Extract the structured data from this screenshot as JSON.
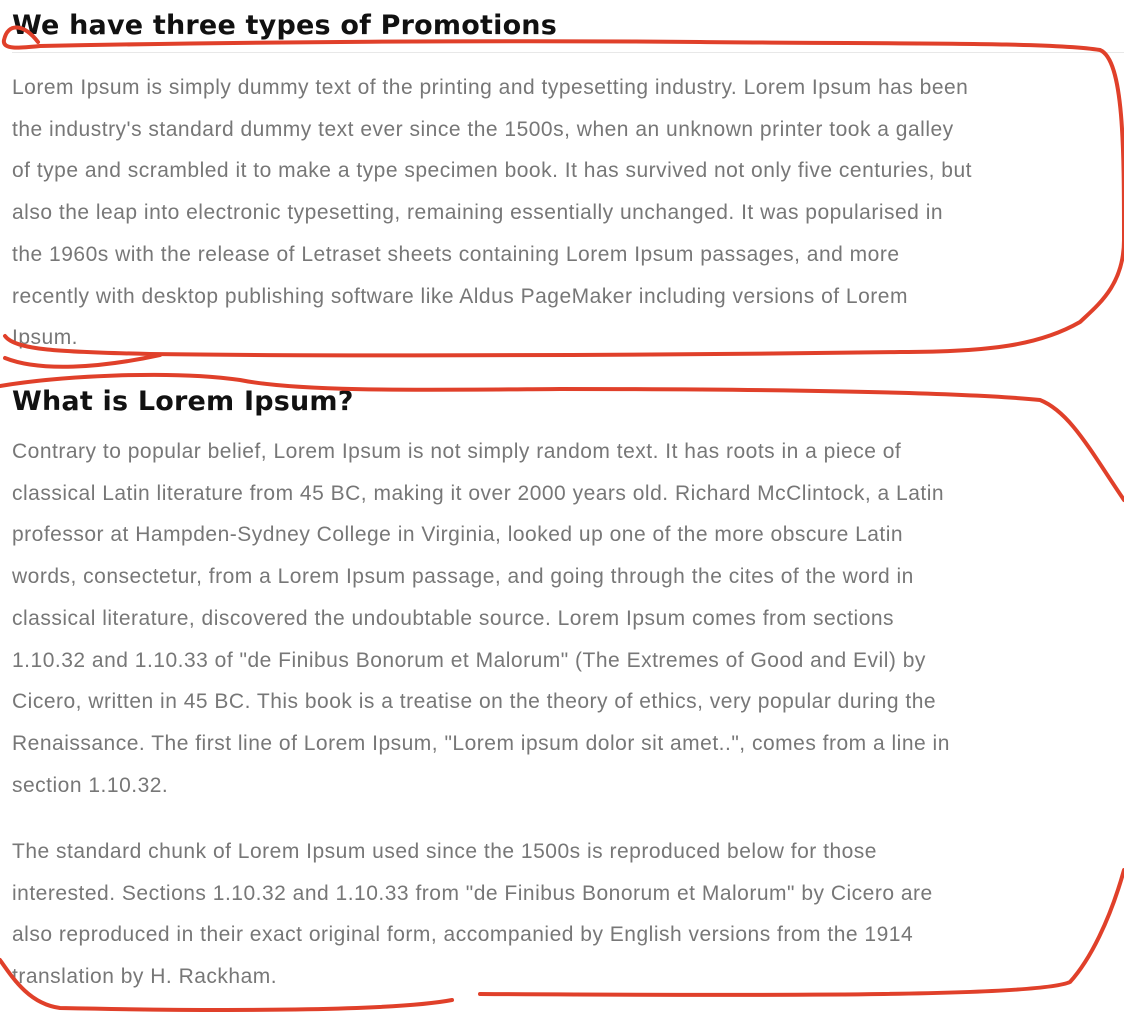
{
  "promotions": {
    "heading": "We have three types of Promotions",
    "paragraph_lines": [
      "Lorem Ipsum is simply dummy text of the printing and typesetting industry. Lorem Ipsum has been",
      "the industry's standard dummy text ever since the 1500s, when an unknown printer took a galley",
      "of type and scrambled it to make a type specimen book. It has survived not only five centuries, but",
      "also the leap into electronic typesetting, remaining essentially unchanged. It was popularised in",
      "the 1960s with the release of Letraset sheets containing Lorem Ipsum passages, and more",
      "recently with desktop publishing software like Aldus PageMaker including versions of Lorem",
      "Ipsum."
    ]
  },
  "lorem_section": {
    "heading": "What is Lorem Ipsum?",
    "paragraph1_lines": [
      "Contrary to popular belief, Lorem Ipsum is not simply random text. It has roots in a piece of",
      "classical Latin literature from 45 BC, making it over 2000 years old. Richard McClintock, a Latin",
      "professor at Hampden-Sydney College in Virginia, looked up one of the more obscure Latin",
      "words, consectetur, from a Lorem Ipsum passage, and going through the cites of the word in",
      "classical literature, discovered the undoubtable source. Lorem Ipsum comes from sections",
      "1.10.32 and 1.10.33 of \"de Finibus Bonorum et Malorum\" (The Extremes of Good and Evil) by",
      "Cicero, written in 45 BC. This book is a treatise on the theory of ethics, very popular during the",
      "Renaissance. The first line of Lorem Ipsum, \"Lorem ipsum dolor sit amet..\", comes from a line in",
      "section 1.10.32."
    ],
    "paragraph2_lines": [
      "The standard chunk of Lorem Ipsum used since the 1500s is reproduced below for those",
      "interested. Sections 1.10.32 and 1.10.33 from \"de Finibus Bonorum et Malorum\" by Cicero are",
      "also reproduced in their exact original form, accompanied by English versions from the 1914",
      "translation by H. Rackham."
    ]
  },
  "annotation_color": "#e0402a"
}
